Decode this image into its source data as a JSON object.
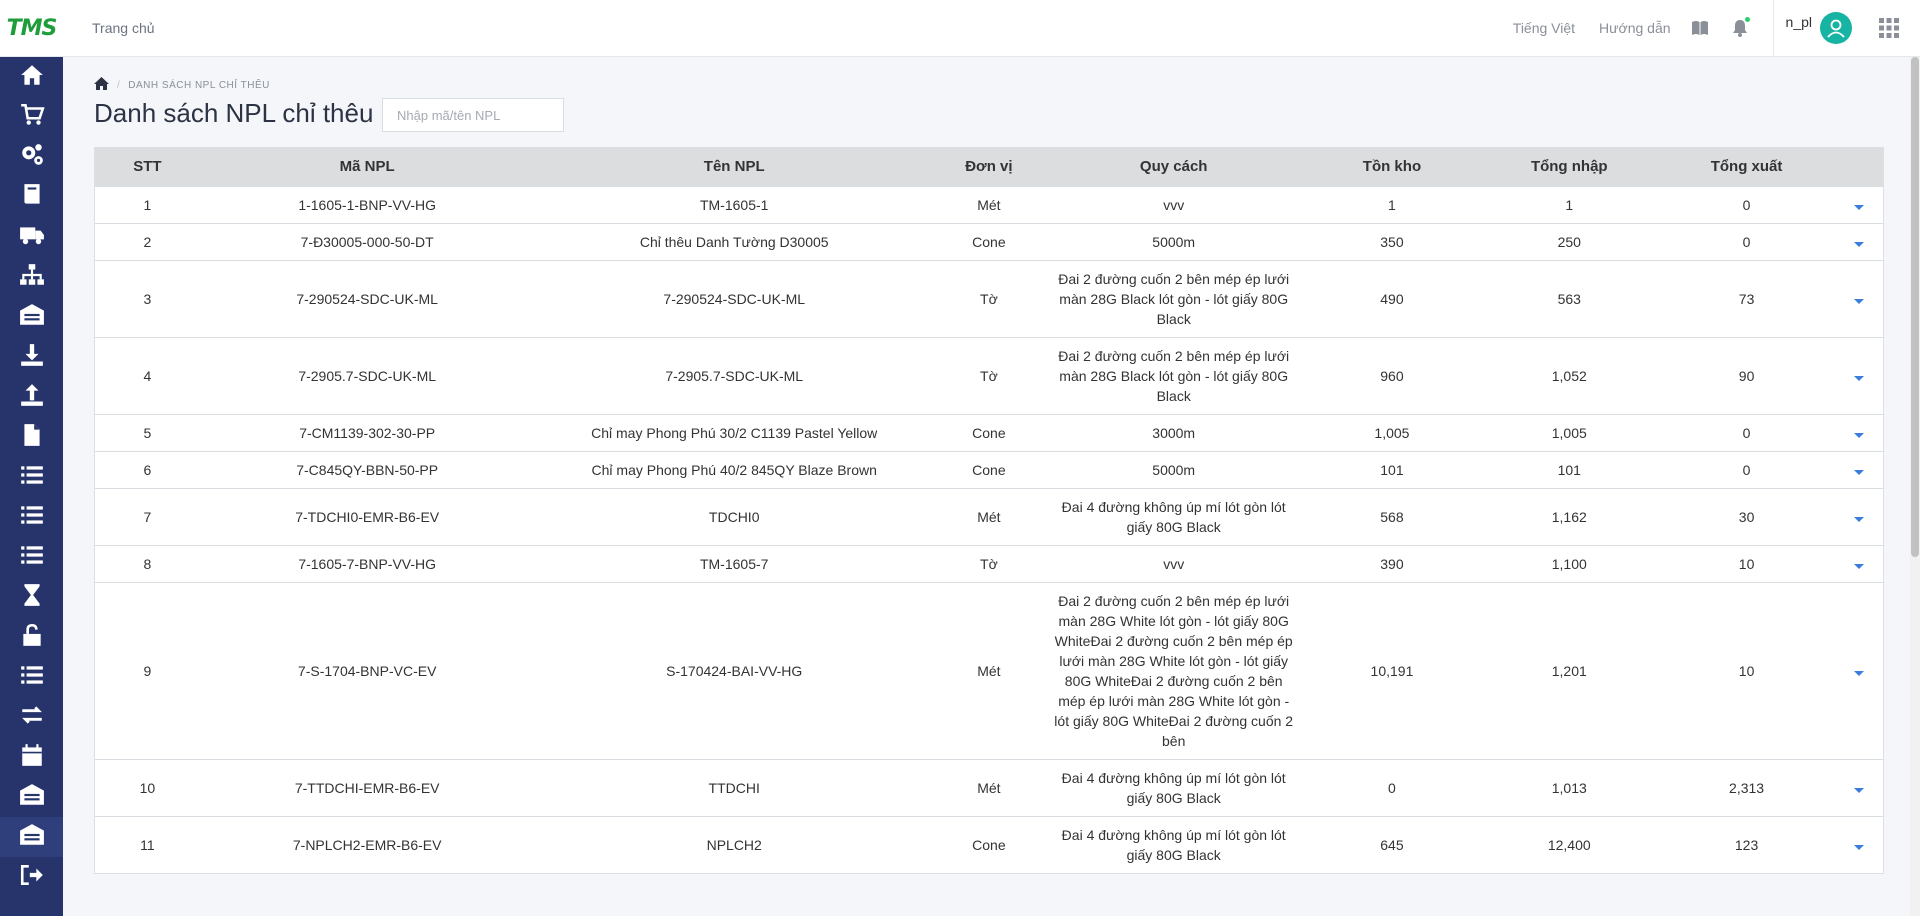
{
  "header": {
    "logo_text": "TMS",
    "home_link": "Trang chủ",
    "language": "Tiếng Việt",
    "guide": "Hướng dẫn",
    "username": "n_pl"
  },
  "sidebar": {
    "items": [
      {
        "icon": "home-icon"
      },
      {
        "icon": "cart-icon"
      },
      {
        "icon": "gears-icon"
      },
      {
        "icon": "book-icon"
      },
      {
        "icon": "truck-icon"
      },
      {
        "icon": "sitemap-icon"
      },
      {
        "icon": "warehouse-icon"
      },
      {
        "icon": "download-icon"
      },
      {
        "icon": "upload-icon"
      },
      {
        "icon": "file-icon"
      },
      {
        "icon": "list-icon"
      },
      {
        "icon": "list-icon"
      },
      {
        "icon": "list-icon"
      },
      {
        "icon": "hourglass-icon"
      },
      {
        "icon": "unlock-icon"
      },
      {
        "icon": "list-icon"
      },
      {
        "icon": "exchange-icon"
      },
      {
        "icon": "calendar-icon"
      },
      {
        "icon": "warehouse-icon"
      },
      {
        "icon": "warehouse-icon",
        "active": true
      },
      {
        "icon": "logout-icon"
      }
    ]
  },
  "breadcrumb": {
    "current": "DANH SÁCH NPL CHỈ THÊU"
  },
  "page": {
    "title": "Danh sách NPL chỉ thêu",
    "search_placeholder": "Nhập mã/tên NPL"
  },
  "table": {
    "headers": {
      "stt": "STT",
      "ma": "Mã NPL",
      "ten": "Tên NPL",
      "dv": "Đơn vị",
      "qc": "Quy cách",
      "ton": "Tồn kho",
      "nhap": "Tổng nhập",
      "xuat": "Tổng xuất"
    },
    "rows": [
      {
        "stt": "1",
        "ma": "1-1605-1-BNP-VV-HG",
        "ten": "TM-1605-1",
        "dv": "Mét",
        "qc": "vvv",
        "ton": "1",
        "nhap": "1",
        "xuat": "0"
      },
      {
        "stt": "2",
        "ma": "7-Đ30005-000-50-DT",
        "ten": "Chỉ thêu Danh Tường D30005",
        "dv": "Cone",
        "qc": "5000m",
        "ton": "350",
        "nhap": "250",
        "xuat": "0"
      },
      {
        "stt": "3",
        "ma": "7-290524-SDC-UK-ML",
        "ten": "7-290524-SDC-UK-ML",
        "dv": "Tờ",
        "qc": "Đai 2 đường cuốn 2 bên mép ép lưới màn 28G Black lót gòn - lót giấy 80G Black",
        "ton": "490",
        "nhap": "563",
        "xuat": "73"
      },
      {
        "stt": "4",
        "ma": "7-2905.7-SDC-UK-ML",
        "ten": "7-2905.7-SDC-UK-ML",
        "dv": "Tờ",
        "qc": "Đai 2 đường cuốn 2 bên mép ép lưới màn 28G Black lót gòn - lót giấy 80G Black",
        "ton": "960",
        "nhap": "1,052",
        "xuat": "90"
      },
      {
        "stt": "5",
        "ma": "7-CM1139-302-30-PP",
        "ten": "Chỉ may Phong Phú 30/2 C1139 Pastel Yellow",
        "dv": "Cone",
        "qc": "3000m",
        "ton": "1,005",
        "nhap": "1,005",
        "xuat": "0"
      },
      {
        "stt": "6",
        "ma": "7-C845QY-BBN-50-PP",
        "ten": "Chỉ may Phong Phú 40/2 845QY Blaze Brown",
        "dv": "Cone",
        "qc": "5000m",
        "ton": "101",
        "nhap": "101",
        "xuat": "0"
      },
      {
        "stt": "7",
        "ma": "7-TDCHI0-EMR-B6-EV",
        "ten": "TDCHI0",
        "dv": "Mét",
        "qc": "Đai 4 đường không úp mí lót gòn lót giấy 80G Black",
        "ton": "568",
        "nhap": "1,162",
        "xuat": "30"
      },
      {
        "stt": "8",
        "ma": "7-1605-7-BNP-VV-HG",
        "ten": "TM-1605-7",
        "dv": "Tờ",
        "qc": "vvv",
        "ton": "390",
        "nhap": "1,100",
        "xuat": "10"
      },
      {
        "stt": "9",
        "ma": "7-S-1704-BNP-VC-EV",
        "ten": "S-170424-BAI-VV-HG",
        "dv": "Mét",
        "qc": "Đai 2 đường cuốn 2 bên mép ép lưới màn 28G White lót gòn - lót giấy 80G WhiteĐai 2 đường cuốn 2 bên mép ép lưới màn 28G White lót gòn - lót giấy 80G WhiteĐai 2 đường cuốn 2 bên mép ép lưới màn 28G White lót gòn - lót giấy 80G WhiteĐai 2 đường cuốn 2 bên",
        "ton": "10,191",
        "nhap": "1,201",
        "xuat": "10"
      },
      {
        "stt": "10",
        "ma": "7-TTDCHI-EMR-B6-EV",
        "ten": "TTDCHI",
        "dv": "Mét",
        "qc": "Đai 4 đường không úp mí lót gòn lót giấy 80G Black",
        "ton": "0",
        "nhap": "1,013",
        "xuat": "2,313"
      },
      {
        "stt": "11",
        "ma": "7-NPLCH2-EMR-B6-EV",
        "ten": "NPLCH2",
        "dv": "Cone",
        "qc": "Đai 4 đường không úp mí lót gòn lót giấy 80G Black",
        "ton": "645",
        "nhap": "12,400",
        "xuat": "123"
      }
    ]
  }
}
